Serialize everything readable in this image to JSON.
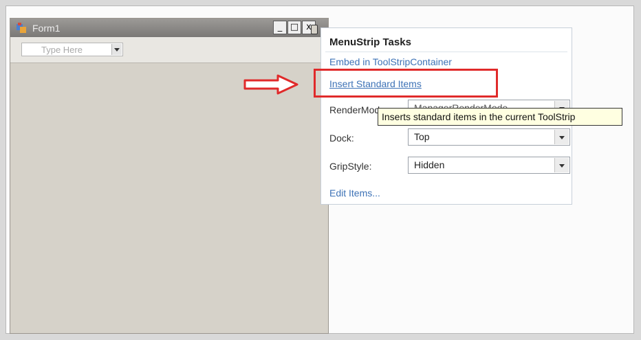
{
  "form": {
    "title": "Form1",
    "window_buttons": {
      "minimize": "_",
      "maximize": "□",
      "close": "x"
    },
    "menustrip": {
      "placeholder": "Type Here"
    }
  },
  "tasks_panel": {
    "title": "MenuStrip Tasks",
    "links": {
      "embed": "Embed in ToolStripContainer",
      "insert": "Insert Standard Items",
      "edit": "Edit Items..."
    },
    "properties": {
      "render_mode": {
        "label": "RenderMode:",
        "value": "ManagerRenderMode"
      },
      "dock": {
        "label": "Dock:",
        "value": "Top"
      },
      "grip_style": {
        "label": "GripStyle:",
        "value": "Hidden"
      }
    }
  },
  "tooltip": {
    "text": "Inserts standard items in the current ToolStrip"
  },
  "icons": [
    "form-app-icon",
    "minimize-icon",
    "maximize-icon",
    "close-icon",
    "smart-tag-glyph-icon",
    "red-arrow-icon"
  ],
  "colors": {
    "highlight": "#e02a2a",
    "link": "#3d72b6",
    "tooltip_bg": "#ffffe1"
  }
}
